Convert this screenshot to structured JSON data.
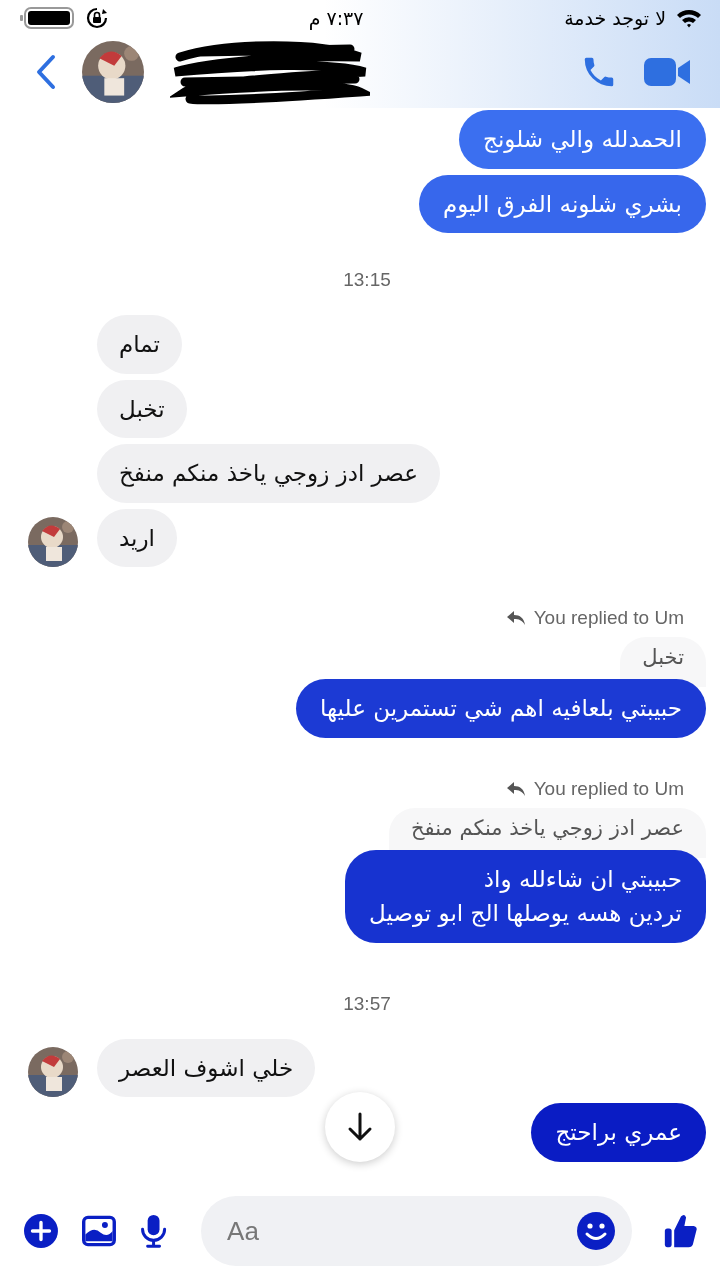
{
  "status_bar": {
    "carrier": "لا توجد خدمة",
    "time": "٧:٣٧ م"
  },
  "header": {
    "redacted": true
  },
  "messages": [
    {
      "kind": "outgoing",
      "text": "الحمدلله والي شلونج"
    },
    {
      "kind": "outgoing",
      "text": "بشري شلونه الفرق اليوم"
    },
    {
      "kind": "time",
      "text": "13:15"
    },
    {
      "kind": "incoming",
      "text": "تمام",
      "avatar": false
    },
    {
      "kind": "incoming",
      "text": "تخبل",
      "avatar": false
    },
    {
      "kind": "incoming",
      "text": "عصر ادز زوجي ياخذ منكم منفخ",
      "avatar": false
    },
    {
      "kind": "incoming",
      "text": "اريد",
      "avatar": true
    },
    {
      "kind": "reply",
      "label": "You replied to Um",
      "quote": "تخبل",
      "text": "حبيبتي بلعافيه اهم شي تستمرين عليها"
    },
    {
      "kind": "reply",
      "label": "You replied to Um",
      "quote": "عصر ادز زوجي ياخذ منكم منفخ",
      "text": "حبيبتي  ان شاءلله  واذ\nتردين هسه يوصلها الج ابو توصيل"
    },
    {
      "kind": "time",
      "text": "13:57"
    },
    {
      "kind": "incoming",
      "text": "خلي اشوف العصر",
      "avatar": true
    },
    {
      "kind": "outgoing",
      "text": "عمري براحتج"
    }
  ],
  "composer": {
    "placeholder": "Aa"
  }
}
